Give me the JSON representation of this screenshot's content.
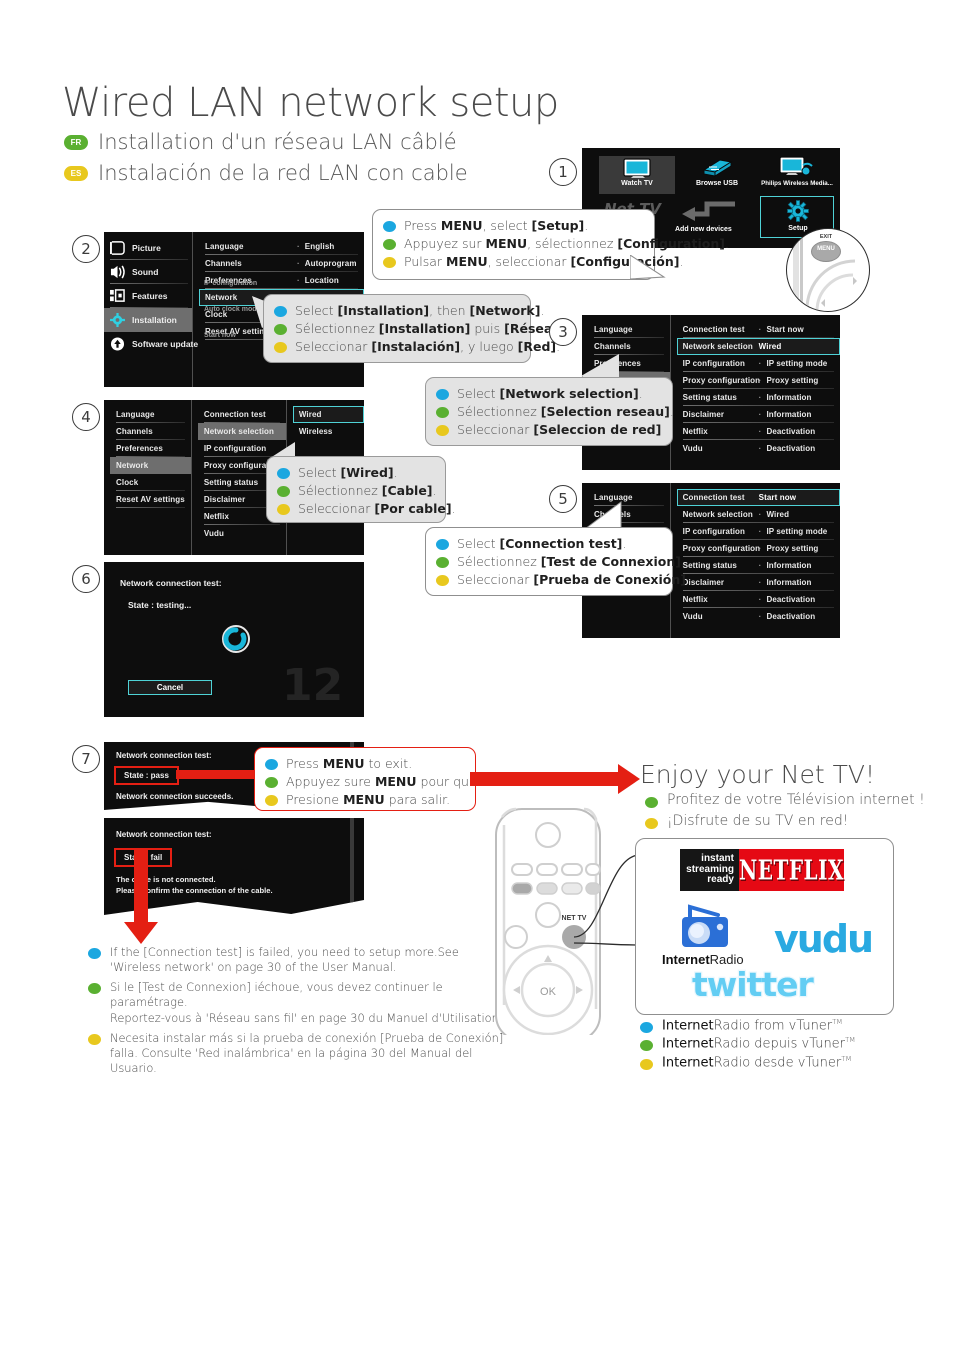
{
  "page": {
    "title": "Wired LAN network setup",
    "subtitle_fr": "Installation d'un réseau LAN câblé",
    "subtitle_es": "Instalación de la red LAN con cable",
    "badge_fr": "FR",
    "badge_es": "ES",
    "page_number": "12"
  },
  "colors": {
    "en_dot": "#1ba7e0",
    "fr_dot": "#5ab031",
    "es_dot": "#e8c81e",
    "highlight": "#4fd2d6",
    "red": "#e41f13",
    "netflix_red": "#e50914",
    "vudu_blue": "#29a9e1",
    "twitter_blue": "#63cdf3"
  },
  "steps": {
    "s1": "1",
    "s2": "2",
    "s3": "3",
    "s4": "4",
    "s5": "5",
    "s6": "6",
    "s7": "7"
  },
  "home_menu": {
    "items": [
      {
        "label": "Watch TV",
        "icon": "tv-icon"
      },
      {
        "label": "Browse USB",
        "icon": "usb-icon"
      },
      {
        "label": "Philips Wireless Media...",
        "icon": "wireless-media-icon"
      },
      {
        "label": "Net TV",
        "icon": "nettv-icon"
      },
      {
        "label": "Add new devices",
        "icon": "add-device-icon"
      },
      {
        "label": "Setup",
        "icon": "gear-icon"
      }
    ],
    "selected": "Setup"
  },
  "remote_keys": {
    "exit": "EXIT",
    "menu": "MENU",
    "nettv": "NET TV",
    "ok": "OK"
  },
  "callout1": {
    "en": {
      "pre": "Press ",
      "key": "MENU",
      "mid": ", select ",
      "bracket": "[Setup]",
      "post": "."
    },
    "fr": {
      "pre": "Appuyez sur ",
      "key": "MENU",
      "mid": ", sélectionnez ",
      "bracket": "[Configuration]",
      "post": "."
    },
    "es": {
      "pre": "Pulsar ",
      "key": "MENU",
      "mid": ", seleccionar ",
      "bracket": "[Configuración]",
      "post": "."
    }
  },
  "callout2": {
    "en": {
      "pre": "Select ",
      "bracket": "[Installation]",
      "mid": ", then ",
      "bracket2": "[Network]",
      "post": "."
    },
    "fr": {
      "pre": "Sélectionnez ",
      "bracket": "[Installation]",
      "mid": " puis ",
      "bracket2": "[Réseau]",
      "post": "."
    },
    "es": {
      "pre": "Seleccionar ",
      "bracket": "[Instalación]",
      "mid": ", y luego ",
      "bracket2": "[Red]",
      "post": "."
    }
  },
  "callout3": {
    "en": {
      "pre": "Select ",
      "bracket": "[Network selection]",
      "post": "."
    },
    "fr": {
      "pre": "Sélectionnez ",
      "bracket": "[Selection reseau]",
      "post": "."
    },
    "es": {
      "pre": "Seleccionar ",
      "bracket": "[Seleccion de red]",
      "post": ""
    }
  },
  "callout4": {
    "en": {
      "pre": "Select ",
      "bracket": "[Wired]",
      "post": "."
    },
    "fr": {
      "pre": "Sélectionnez ",
      "bracket": "[Cable]",
      "post": "."
    },
    "es": {
      "pre": "Seleccionar ",
      "bracket": "[Por cable]",
      "post": "."
    }
  },
  "callout5": {
    "en": {
      "pre": "Select ",
      "bracket": "[Connection test]",
      "post": "."
    },
    "fr": {
      "pre": "Sélectionnez ",
      "bracket": "[Test de Connexion]",
      "post": "."
    },
    "es": {
      "pre": "Seleccionar ",
      "bracket": "[Prueba de Conexión]",
      "post": "."
    }
  },
  "callout7": {
    "en": {
      "pre": "Press ",
      "key": "MENU",
      "post": " to exit."
    },
    "fr": {
      "pre": "Appuyez sure ",
      "key": "MENU",
      "post": " pour quitter."
    },
    "es": {
      "pre": "Presione ",
      "key": "MENU",
      "post": " para salir."
    }
  },
  "setup_menu_left": {
    "items": [
      "Picture",
      "Sound",
      "Features",
      "Installation",
      "Software update"
    ],
    "selected": "Installation",
    "icons": [
      "picture-icon",
      "sound-icon",
      "features-icon",
      "installation-gear-icon",
      "software-update-icon"
    ]
  },
  "installation_menu": {
    "items": [
      "Language",
      "Channels",
      "Preferences",
      "Network",
      "Clock",
      "Reset AV settings"
    ],
    "values": [
      "English",
      "Autoprogram",
      "Location",
      "",
      "",
      ""
    ],
    "selected": "Network"
  },
  "network_menu": {
    "items": [
      "Connection test",
      "Network selection",
      "IP configuration",
      "Proxy configuration",
      "Setting status",
      "Disclaimer",
      "Netflix",
      "Vudu"
    ],
    "values": [
      "Start now",
      "Wired",
      "IP setting mode",
      "Proxy setting",
      "Information",
      "Information",
      "Deactivation",
      "Deactivation"
    ],
    "selected_step3": "Network selection",
    "selected_step5": "Connection test",
    "hidden_items": [
      "IP configuration",
      "Auto clock mode",
      "Start now"
    ]
  },
  "network_selection_options": {
    "items": [
      "Wired",
      "Wireless"
    ],
    "selected": "Wired"
  },
  "left_column_step4": {
    "items": [
      "Language",
      "Channels",
      "Preferences",
      "Network",
      "Clock",
      "Reset AV settings"
    ],
    "selected": "Network"
  },
  "test_testing": {
    "title": "Network connection test:",
    "state": "State : testing...",
    "cancel": "Cancel"
  },
  "test_pass": {
    "title": "Network connection test:",
    "state": "State : pass",
    "message": "Network connection succeeds."
  },
  "test_fail": {
    "title": "Network connection test:",
    "state": "State : fail",
    "message_line1": "The cable is not connected.",
    "message_line2": "Please confirm the connection of the cable."
  },
  "footnotes": {
    "en_l1": "If the [Connection test] is failed, you need to setup more.See",
    "en_l2": "'Wireless network' on page 30 of the User Manual.",
    "en_bold": "[Connection test]",
    "fr_l1": "Si le [Test de Connexion] iéchoue, vous devez continuer le paramétrage.",
    "fr_l2": "Reportez-vous à 'Réseau sans fil' en page 30 du Manuel d'Utilisation.",
    "fr_bold": "[Test de Connexion]",
    "es_l1": "Necesita instalar más  si la prueba de conexión [Prueba de Conexión]",
    "es_l2": "falla. Consulte 'Red inalámbrica' en la página 30 del Manual del Usuario.",
    "es_bold": "[Prueba de Conexión]"
  },
  "enjoy": {
    "title": "Enjoy your Net TV!",
    "fr": "Profitez de votre Télévision internet !",
    "es": "¡Disfrute de su TV en red!"
  },
  "logos": {
    "netflix_badge_l1": "instant",
    "netflix_badge_l2": "streaming",
    "netflix_badge_l3": "ready",
    "netflix": "NETFLIX",
    "internet_radio_bold": "Internet",
    "internet_radio_rest": "Radio",
    "vudu": "vudu",
    "twitter": "twitter"
  },
  "vtuner": {
    "en_bold": "Internet",
    "en_rest": "Radio from vTuner",
    "fr_bold": "Internet",
    "fr_rest": "Radio depuis vTuner",
    "es_bold": "Internet",
    "es_rest": "Radio desde vTuner",
    "tm": "TM"
  }
}
